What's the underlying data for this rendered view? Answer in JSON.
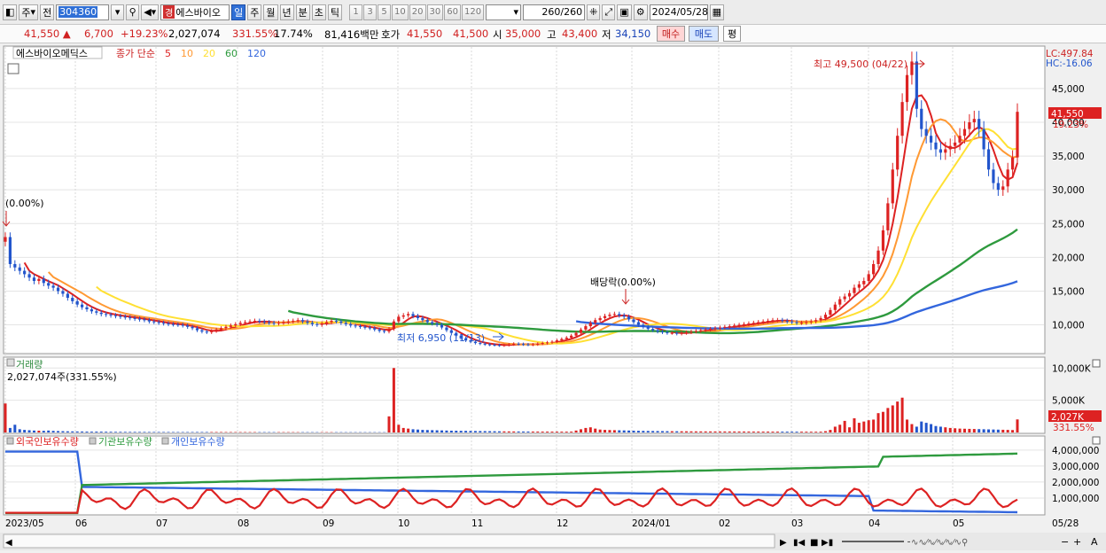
{
  "toolbar": {
    "market": "주",
    "prev_label": "전",
    "code": "304360",
    "stock_name": "에스바이오",
    "stock_badge": "경",
    "periods": [
      "일",
      "주",
      "월",
      "년",
      "분",
      "초",
      "틱"
    ],
    "active_period": "일",
    "intervals": [
      "1",
      "3",
      "5",
      "10",
      "20",
      "30",
      "60",
      "120"
    ],
    "count_display": "260",
    "count_total": "/260",
    "date": "2024/05/28"
  },
  "infobar": {
    "price": "41,550 ▲",
    "change": "6,700",
    "change_pct": "+19.23%",
    "volume": "2,027,074",
    "volume_pct": "331.55%",
    "turnover": "17.74%",
    "amount": "81,416백만",
    "quote_label": "호가",
    "ask": "41,550",
    "bid": "41,500",
    "open_label": "시",
    "open": "35,000",
    "high_label": "고",
    "high": "43,400",
    "low_label": "저",
    "low": "34,150",
    "buy_label": "매수",
    "sell_label": "매도",
    "eval_label": "평"
  },
  "legend": {
    "name": "에스바이오메딕스",
    "series_label": "종가 단순",
    "ma": [
      {
        "period": "5",
        "color": "#dd2222"
      },
      {
        "period": "10",
        "color": "#ff9933"
      },
      {
        "period": "20",
        "color": "#ffe033"
      },
      {
        "period": "60",
        "color": "#2e9a3e"
      },
      {
        "period": "120",
        "color": "#3366dd"
      }
    ]
  },
  "annotations": {
    "lc": "LC:497.84",
    "hc": "HC:-16.06",
    "high_note": "최고 49,500 (04/22)",
    "low_note": "최저 6,950 (11/13)",
    "dividend_note": "배당락(0.00%)",
    "start_note": "(0.00%)",
    "price_tag": "41,550",
    "pct_tag": "19.23%",
    "volume_label": "거래량",
    "volume_note": "2,027,074주(331.55%)",
    "volume_tag": "2,027K",
    "volume_pct_tag": "331.55%"
  },
  "holdings_legend": [
    "외국인보유수량",
    "기관보유수량",
    "개인보유수량"
  ],
  "x_labels": [
    "2023/05",
    "06",
    "07",
    "08",
    "09",
    "10",
    "11",
    "12",
    "2024/01",
    "02",
    "03",
    "04",
    "05"
  ],
  "x_end_label": "05/28",
  "colors": {
    "up": "#dd2222",
    "down": "#2255cc",
    "bg": "#ffffff",
    "grid": "#e4e4e4"
  },
  "chart_data": {
    "type": "candlestick",
    "x_range": [
      "2023/05",
      "2024/05/28"
    ],
    "price": {
      "ylim": [
        6000,
        50500
      ],
      "yticks": [
        10000,
        15000,
        20000,
        25000,
        30000,
        35000,
        40000,
        45000
      ],
      "ytick_labels": [
        "10,000",
        "15,000",
        "20,000",
        "25,000",
        "30,000",
        "35,000",
        "40,000",
        "45,000"
      ],
      "close": [
        23000,
        19000,
        18500,
        18000,
        17500,
        17000,
        16500,
        16800,
        16200,
        15800,
        15500,
        15000,
        14600,
        14000,
        13500,
        13000,
        12600,
        12300,
        12000,
        11800,
        11600,
        11500,
        11400,
        11300,
        11200,
        11100,
        11000,
        10900,
        10800,
        10700,
        10500,
        10400,
        10300,
        10200,
        10100,
        10050,
        10000,
        9900,
        9700,
        9500,
        9200,
        9000,
        8900,
        9100,
        9300,
        9500,
        9700,
        9900,
        10100,
        10300,
        10400,
        10500,
        10600,
        10500,
        10400,
        10300,
        10200,
        10300,
        10400,
        10500,
        10600,
        10700,
        10500,
        10300,
        10100,
        10000,
        10200,
        10400,
        10600,
        10500,
        10300,
        10100,
        9900,
        9800,
        9700,
        9600,
        9500,
        9300,
        9100,
        9000,
        9400,
        10500,
        11200,
        11400,
        11600,
        11300,
        11000,
        10700,
        10400,
        10200,
        10000,
        9600,
        9200,
        8800,
        8400,
        8000,
        7700,
        7500,
        7300,
        7200,
        7100,
        7050,
        7000,
        6950,
        7000,
        7100,
        7200,
        7150,
        7100,
        7050,
        7100,
        7200,
        7300,
        7400,
        7500,
        7700,
        7900,
        8100,
        8400,
        8800,
        9300,
        9800,
        10300,
        10700,
        11000,
        11300,
        11500,
        11600,
        11400,
        11200,
        10800,
        10400,
        10000,
        9700,
        9400,
        9200,
        9000,
        8900,
        8800,
        8800,
        8700,
        8800,
        8900,
        9000,
        9100,
        9200,
        9300,
        9400,
        9500,
        9600,
        9700,
        9800,
        9900,
        10000,
        10100,
        10200,
        10300,
        10400,
        10500,
        10600,
        10700,
        10700,
        10600,
        10500,
        10400,
        10300,
        10300,
        10400,
        10500,
        10700,
        11000,
        11500,
        12200,
        13000,
        13800,
        14200,
        14700,
        15500,
        16000,
        16500,
        17500,
        19000,
        21000,
        24000,
        28000,
        33000,
        38000,
        43000,
        47000,
        49000,
        42000,
        39000,
        38000,
        37000,
        36000,
        35500,
        36000,
        36500,
        37000,
        38000,
        39000,
        40000,
        40500,
        39000,
        36000,
        33000,
        31000,
        30000,
        30500,
        33000,
        34800,
        41550
      ]
    },
    "moving_averages": {
      "periods": [
        5,
        10,
        20,
        60,
        120
      ],
      "series": [
        {
          "name": "5",
          "values": [
            23000,
            19000,
            18500,
            18000,
            17500,
            17000,
            16500,
            16800,
            16200,
            15800,
            15500,
            15000,
            14600,
            14000,
            13500,
            13000,
            12600,
            12300,
            12000,
            11800,
            11600,
            11500,
            11400,
            11300,
            11200,
            11100,
            11000,
            10900,
            10800,
            10700,
            10500,
            10400,
            10300,
            10200,
            10100,
            10050,
            10000,
            9900,
            9700,
            9500,
            9200,
            9000,
            8900,
            9100,
            9300,
            9500,
            9700,
            9900,
            10100,
            10300,
            10400,
            10500,
            10600,
            10500,
            10400,
            10300,
            10200,
            10300,
            10400,
            10500,
            10600,
            10700,
            10500,
            10300,
            10100,
            10000,
            10200,
            10400,
            10600,
            10500,
            10300,
            10100,
            9900,
            9800,
            9700,
            9600,
            9500,
            9300,
            9100,
            9000,
            9400,
            10500,
            11200,
            11400,
            11600,
            11300,
            11000,
            10700,
            10400,
            10200,
            10000,
            9600,
            9200,
            8800,
            8400,
            8000,
            7700,
            7500,
            7300,
            7200,
            7100,
            7050,
            7000,
            6950,
            7000,
            7100,
            7200,
            7150,
            7100,
            7050,
            7100,
            7200,
            7300,
            7400,
            7500,
            7700,
            7900,
            8100,
            8400,
            8800,
            9300,
            9800,
            10300,
            10700,
            11000,
            11300,
            11500,
            11600,
            11400,
            11200,
            10800,
            10400,
            10000,
            9700,
            9400,
            9200,
            9000,
            8900,
            8800,
            8800,
            8700,
            8800,
            8900,
            9000,
            9100,
            9200,
            9300,
            9400,
            9500,
            9600,
            9700,
            9800,
            9900,
            10000,
            10100,
            10200,
            10300,
            10400,
            10500,
            10600,
            10700,
            10700,
            10600,
            10500,
            10400,
            10300,
            10300,
            10400,
            10500,
            10700,
            11000,
            11500,
            12200,
            13000,
            13800,
            14200,
            14700,
            15500,
            16000,
            16500,
            17500,
            19000,
            21000,
            24000,
            28000,
            33000,
            38000,
            43000,
            47000,
            49000,
            42000,
            39000,
            38000,
            37000,
            36000,
            35500,
            36000,
            36500,
            37000,
            38000,
            39000,
            40000,
            40500,
            39000,
            36000,
            33000,
            31000,
            30000,
            30500,
            33000,
            34800,
            41550
          ]
        },
        {
          "name": "10",
          "values": []
        },
        {
          "name": "20",
          "values": []
        },
        {
          "name": "60",
          "values": []
        },
        {
          "name": "120",
          "values": []
        }
      ]
    },
    "volume": {
      "ylim": [
        0,
        11000
      ],
      "yticks": [
        5000,
        10000
      ],
      "ytick_labels": [
        "5,000K",
        "10,000K"
      ],
      "unit": "K",
      "values": [
        4500,
        700,
        1200,
        500,
        400,
        350,
        300,
        280,
        260,
        300,
        250,
        220,
        200,
        180,
        170,
        160,
        150,
        140,
        130,
        140,
        130,
        120,
        110,
        100,
        100,
        95,
        90,
        90,
        85,
        85,
        80,
        80,
        78,
        75,
        75,
        70,
        70,
        68,
        70,
        72,
        75,
        74,
        73,
        72,
        72,
        70,
        68,
        66,
        65,
        64,
        62,
        60,
        60,
        58,
        58,
        57,
        56,
        55,
        55,
        54,
        54,
        53,
        52,
        52,
        51,
        51,
        50,
        50,
        50,
        49,
        49,
        48,
        48,
        48,
        47,
        47,
        47,
        46,
        46,
        45,
        2500,
        10000,
        1200,
        700,
        600,
        500,
        450,
        400,
        380,
        360,
        340,
        320,
        300,
        280,
        270,
        260,
        250,
        240,
        230,
        220,
        210,
        200,
        190,
        180,
        170,
        165,
        160,
        155,
        150,
        148,
        146,
        144,
        142,
        140,
        138,
        136,
        134,
        132,
        140,
        300,
        500,
        700,
        800,
        600,
        450,
        400,
        380,
        360,
        340,
        320,
        300,
        280,
        260,
        250,
        240,
        230,
        220,
        210,
        200,
        195,
        190,
        185,
        180,
        175,
        170,
        168,
        166,
        164,
        162,
        160,
        158,
        156,
        154,
        152,
        150,
        148,
        146,
        144,
        142,
        140,
        138,
        136,
        134,
        132,
        130,
        128,
        126,
        124,
        122,
        120,
        130,
        200,
        400,
        900,
        1200,
        1800,
        800,
        2200,
        1500,
        1700,
        1900,
        2000,
        3000,
        3200,
        3800,
        4200,
        4800,
        5400,
        2000,
        1300,
        900,
        1700,
        1500,
        1300,
        1000,
        900,
        800,
        700,
        650,
        600,
        580,
        560,
        540,
        520,
        500,
        480,
        460,
        440,
        420,
        400,
        380,
        360,
        340,
        320,
        300,
        280,
        260,
        240,
        220,
        200,
        1900,
        2027
      ]
    },
    "holdings": {
      "ylim": [
        0,
        4600000
      ],
      "yticks": [
        1000000,
        2000000,
        3000000,
        4000000
      ],
      "ytick_labels": [
        "1,000,000",
        "2,000,000",
        "3,000,000",
        "4,000,000"
      ],
      "series": [
        {
          "name": "외국인보유수량",
          "color": "#dd2222"
        },
        {
          "name": "기관보유수량",
          "color": "#2e9a3e"
        },
        {
          "name": "개인보유수량",
          "color": "#3366dd"
        }
      ]
    }
  }
}
